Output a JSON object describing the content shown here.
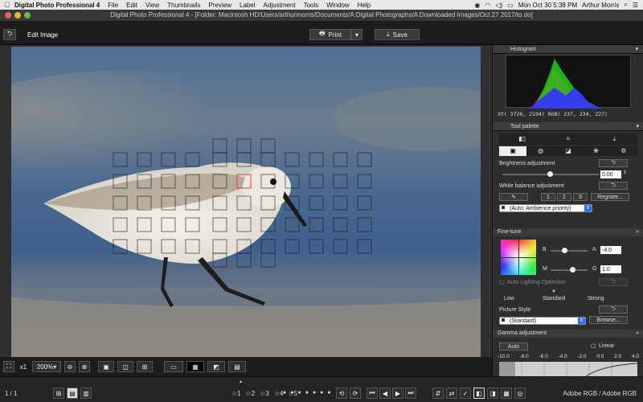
{
  "menubar": {
    "app_name": "Digital Photo Professional 4",
    "items": [
      "File",
      "Edit",
      "View",
      "Thumbnails",
      "Preview",
      "Label",
      "Adjustment",
      "Tools",
      "Window",
      "Help"
    ],
    "clock": "Mon Oct 30  5:38 PM",
    "user": "Arthur Morris"
  },
  "window": {
    "title": "Digital Photo Professional 4 - [Folder: Macintosh HD/Users/arthurmorris/Documents/A Digital Photographs/A Downloaded Images/Oct 27 2017/to do]"
  },
  "toolbar": {
    "mode_label": "Edit Image",
    "print_label": "Print",
    "save_label": "Save"
  },
  "viewer_controls": {
    "zoom_x1": "x1",
    "zoom_level": "200%"
  },
  "status": {
    "page_count": "1 / 1",
    "stars": [
      "1",
      "2",
      "3",
      "4",
      "5"
    ],
    "color_space": "Adobe RGB / Adobe RGB"
  },
  "histogram": {
    "title": "Histogram",
    "readout": "XY( 3726,  2194) RGB( 237, 234, 227)"
  },
  "tool_palette": {
    "title": "Tool palette",
    "brightness": {
      "label": "Brightness adjustment",
      "value": "0.00"
    },
    "white_balance": {
      "label": "White balance adjustment",
      "btn1": "1",
      "btn2": "2",
      "btn3": "3",
      "register": "Register...",
      "mode": "(Auto: Ambience priority)"
    }
  },
  "fine_tune": {
    "title": "Fine-tune",
    "b_label": "B",
    "a_label": "A",
    "a_value": "-4.0",
    "m_label": "M",
    "g_label": "G",
    "g_value": "1.0",
    "alo_label": "Auto Lighting Optimizer",
    "alo_low": "Low",
    "alo_standard": "Standard",
    "alo_strong": "Strong",
    "picture_style_label": "Picture Style",
    "picture_style_value": "(Standard)",
    "browse_label": "Browse..."
  },
  "gamma": {
    "title": "Gamma adjustment",
    "auto_label": "Auto",
    "linear_label": "Linear",
    "scale": [
      "-10.0",
      "-8.0",
      "-6.0",
      "-4.0",
      "-2.0",
      "0.0",
      "2.0",
      "4.0"
    ]
  },
  "colors": {
    "accent": "#2d6ef7",
    "af_active": "#e0413a"
  }
}
